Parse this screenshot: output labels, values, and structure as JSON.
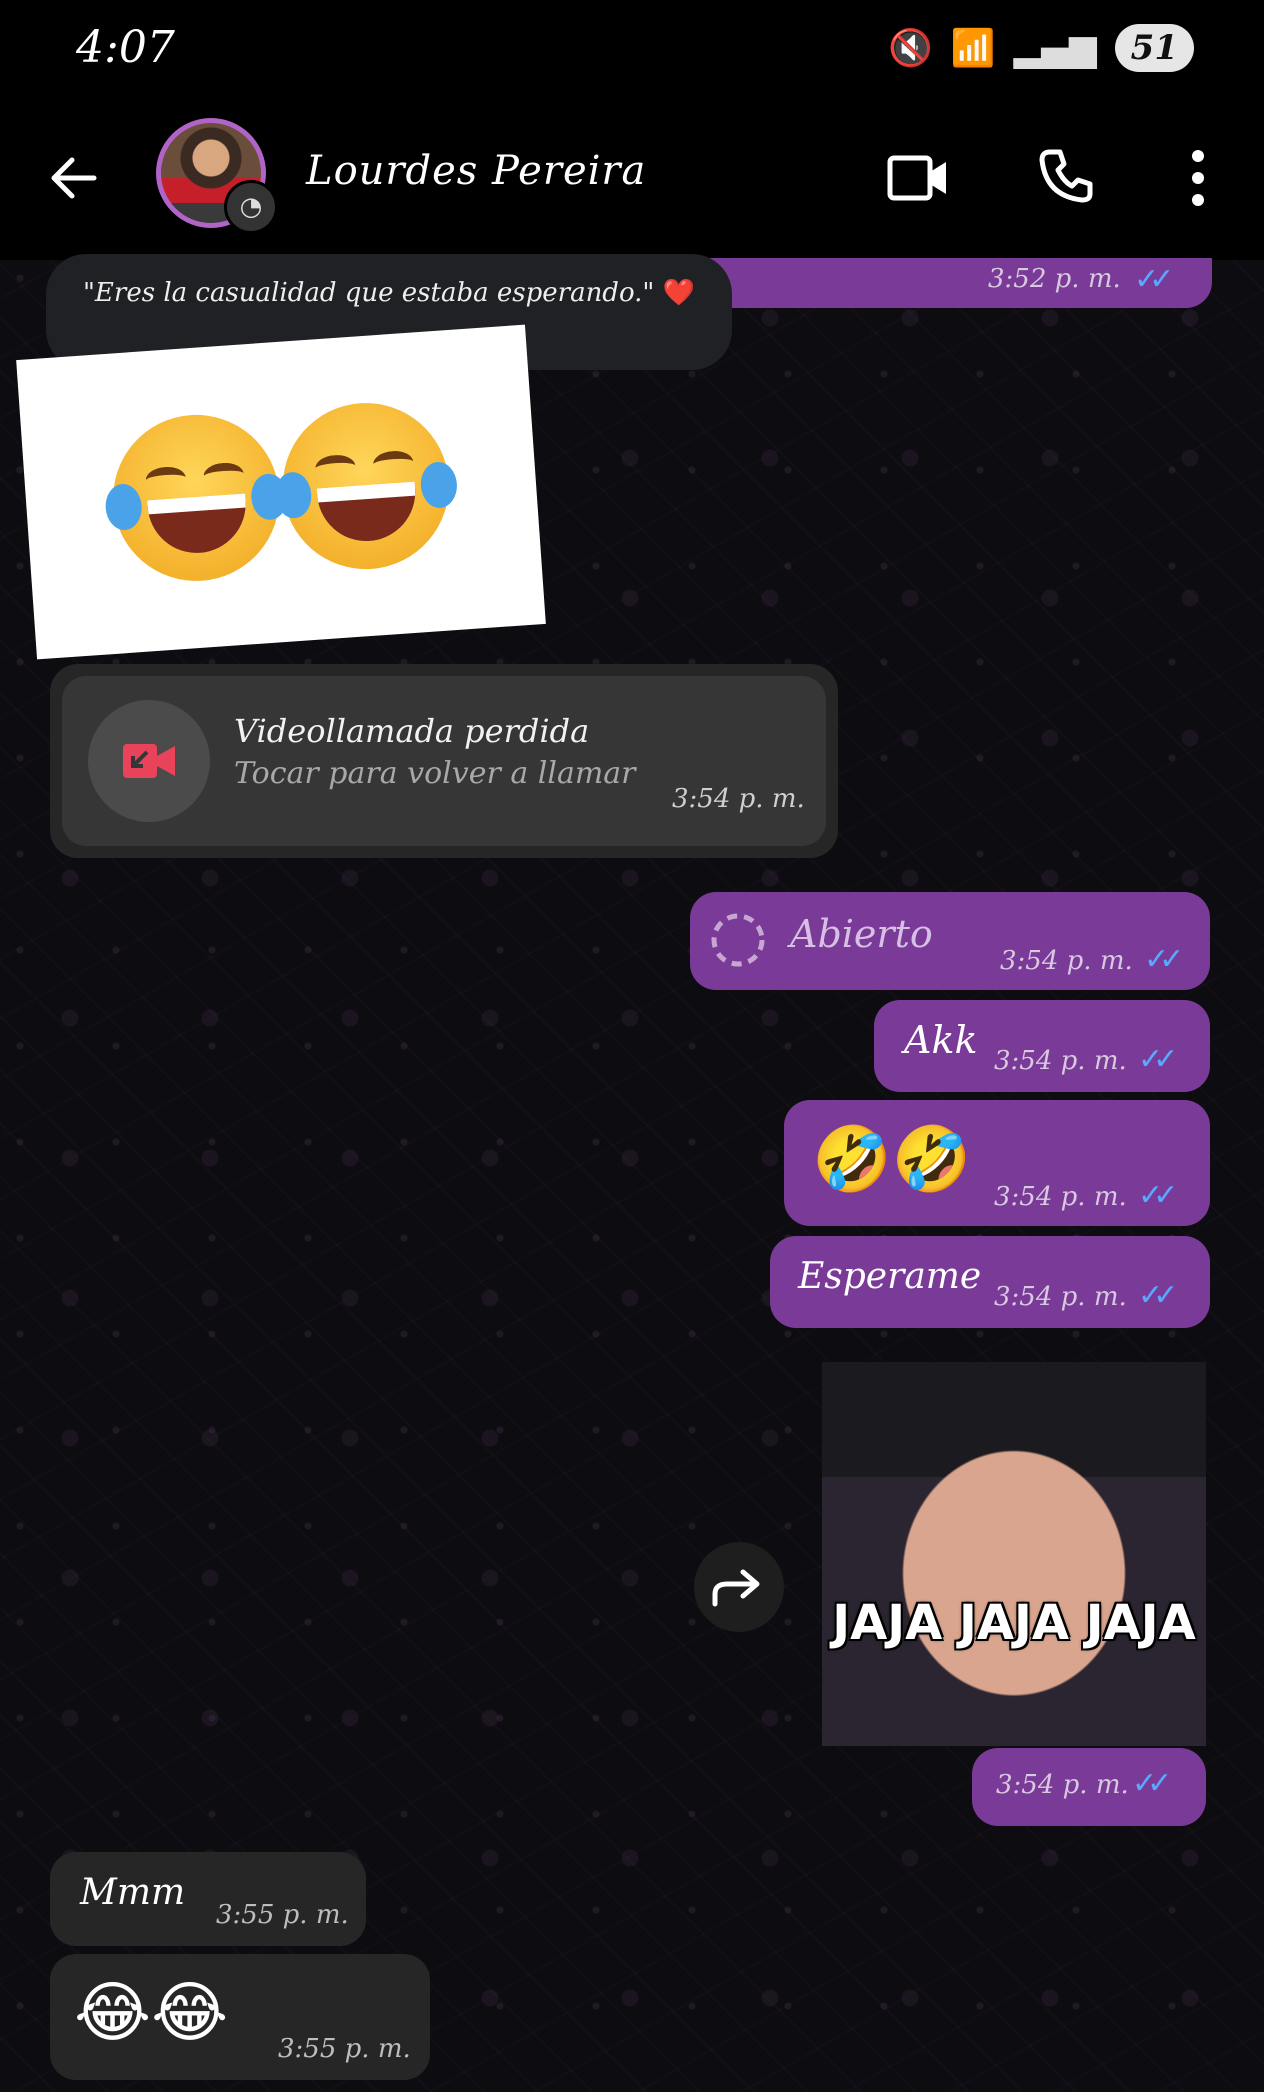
{
  "status_bar": {
    "time": "4:07",
    "battery": "51"
  },
  "header": {
    "contact_name": "Lourdes Pereira"
  },
  "status_tooltip": {
    "text": "\"Eres la casualidad que estaba esperando.\"",
    "emoji": "❤️"
  },
  "messages": {
    "top_partial": {
      "time": "3:52 p. m."
    },
    "missed_call": {
      "title": "Videollamada perdida",
      "subtitle": "Tocar para volver a llamar",
      "time": "3:54 p. m."
    },
    "opened": {
      "text": "Abierto",
      "time": "3:54 p. m."
    },
    "akk": {
      "text": "Akk",
      "time": "3:54 p. m."
    },
    "emoji_rofl": {
      "text": "🤣🤣",
      "time": "3:54 p. m."
    },
    "esperame": {
      "text": "Esperame",
      "time": "3:54 p. m."
    },
    "image": {
      "overlay_text": "JAJA JAJA JAJA",
      "time": "3:54 p. m."
    },
    "mmm": {
      "text": "Mmm",
      "time": "3:55 p. m."
    },
    "emoji_joy": {
      "text": "😂😂",
      "time": "3:55 p. m."
    }
  },
  "icons": {
    "back": "back-arrow-icon",
    "video": "video-call-icon",
    "call": "phone-icon",
    "more": "more-vert-icon",
    "forward": "forward-icon",
    "missed_video": "missed-video-call-icon"
  },
  "colors": {
    "outgoing": "#7a3a97",
    "incoming": "#262626",
    "ticks": "#5aa8ff",
    "missed": "#e8435a"
  }
}
